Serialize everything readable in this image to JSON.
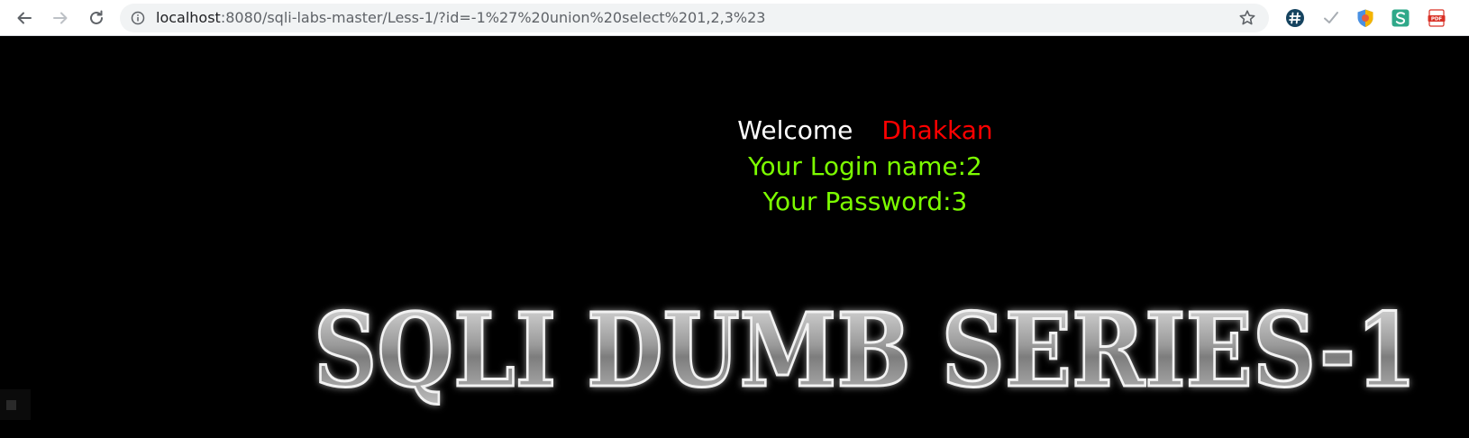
{
  "browser": {
    "url_host": "localhost",
    "url_rest": ":8080/sqli-labs-master/Less-1/?id=-1%27%20union%20select%201,2,3%23",
    "icons": {
      "back": "back-arrow-icon",
      "forward": "forward-arrow-icon",
      "reload": "reload-icon",
      "info": "info-icon",
      "star": "star-icon",
      "extensions": [
        "hash-extension-icon",
        "check-extension-icon",
        "shield-extension-icon",
        "s-extension-icon",
        "pdf-extension-icon"
      ]
    }
  },
  "page": {
    "welcome_label": "Welcome",
    "welcome_name": "Dhakkan",
    "login_line": "Your Login name:2",
    "password_line": "Your Password:3",
    "banner_text": "SQLI DUMB SERIES-1",
    "colors": {
      "background": "#000000",
      "welcome": "#ffffff",
      "name": "#ff0000",
      "result": "#7cfc00"
    }
  }
}
